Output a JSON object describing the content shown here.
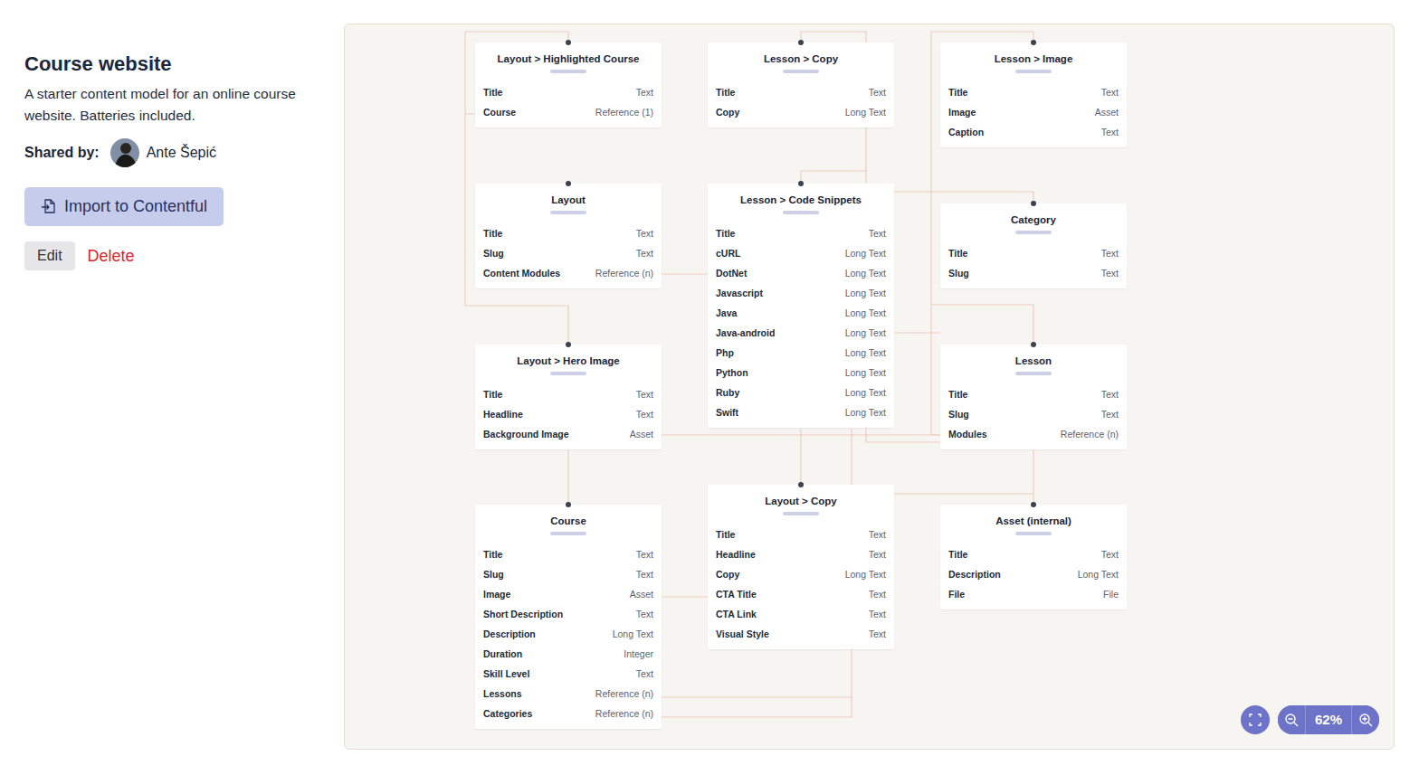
{
  "page": {
    "title": "Course website",
    "description": "A starter content model for an online course website. Batteries included.",
    "shared_by_label": "Shared by:",
    "shared_by_name": "Ante Šepić",
    "import_button": "Import to Contentful",
    "edit_button": "Edit",
    "delete_button": "Delete"
  },
  "diagram": {
    "zoom": "62%",
    "nodes": [
      {
        "title": "Layout > Highlighted Course",
        "fields": [
          {
            "name": "Title",
            "type": "Text"
          },
          {
            "name": "Course",
            "type": "Reference (1)"
          }
        ]
      },
      {
        "title": "Lesson > Copy",
        "fields": [
          {
            "name": "Title",
            "type": "Text"
          },
          {
            "name": "Copy",
            "type": "Long Text"
          }
        ]
      },
      {
        "title": "Lesson > Image",
        "fields": [
          {
            "name": "Title",
            "type": "Text"
          },
          {
            "name": "Image",
            "type": "Asset"
          },
          {
            "name": "Caption",
            "type": "Text"
          }
        ]
      },
      {
        "title": "Layout",
        "fields": [
          {
            "name": "Title",
            "type": "Text"
          },
          {
            "name": "Slug",
            "type": "Text"
          },
          {
            "name": "Content Modules",
            "type": "Reference (n)"
          }
        ]
      },
      {
        "title": "Lesson > Code Snippets",
        "fields": [
          {
            "name": "Title",
            "type": "Text"
          },
          {
            "name": "cURL",
            "type": "Long Text"
          },
          {
            "name": "DotNet",
            "type": "Long Text"
          },
          {
            "name": "Javascript",
            "type": "Long Text"
          },
          {
            "name": "Java",
            "type": "Long Text"
          },
          {
            "name": "Java-android",
            "type": "Long Text"
          },
          {
            "name": "Php",
            "type": "Long Text"
          },
          {
            "name": "Python",
            "type": "Long Text"
          },
          {
            "name": "Ruby",
            "type": "Long Text"
          },
          {
            "name": "Swift",
            "type": "Long Text"
          }
        ]
      },
      {
        "title": "Category",
        "fields": [
          {
            "name": "Title",
            "type": "Text"
          },
          {
            "name": "Slug",
            "type": "Text"
          }
        ]
      },
      {
        "title": "Layout > Hero Image",
        "fields": [
          {
            "name": "Title",
            "type": "Text"
          },
          {
            "name": "Headline",
            "type": "Text"
          },
          {
            "name": "Background Image",
            "type": "Asset"
          }
        ]
      },
      {
        "title": "Lesson",
        "fields": [
          {
            "name": "Title",
            "type": "Text"
          },
          {
            "name": "Slug",
            "type": "Text"
          },
          {
            "name": "Modules",
            "type": "Reference (n)"
          }
        ]
      },
      {
        "title": "Course",
        "fields": [
          {
            "name": "Title",
            "type": "Text"
          },
          {
            "name": "Slug",
            "type": "Text"
          },
          {
            "name": "Image",
            "type": "Asset"
          },
          {
            "name": "Short Description",
            "type": "Text"
          },
          {
            "name": "Description",
            "type": "Long Text"
          },
          {
            "name": "Duration",
            "type": "Integer"
          },
          {
            "name": "Skill Level",
            "type": "Text"
          },
          {
            "name": "Lessons",
            "type": "Reference (n)"
          },
          {
            "name": "Categories",
            "type": "Reference (n)"
          }
        ]
      },
      {
        "title": "Layout > Copy",
        "fields": [
          {
            "name": "Title",
            "type": "Text"
          },
          {
            "name": "Headline",
            "type": "Text"
          },
          {
            "name": "Copy",
            "type": "Long Text"
          },
          {
            "name": "CTA Title",
            "type": "Text"
          },
          {
            "name": "CTA Link",
            "type": "Text"
          },
          {
            "name": "Visual Style",
            "type": "Text"
          }
        ]
      },
      {
        "title": "Asset (internal)",
        "fields": [
          {
            "name": "Title",
            "type": "Text"
          },
          {
            "name": "Description",
            "type": "Long Text"
          },
          {
            "name": "File",
            "type": "File"
          }
        ]
      }
    ]
  }
}
